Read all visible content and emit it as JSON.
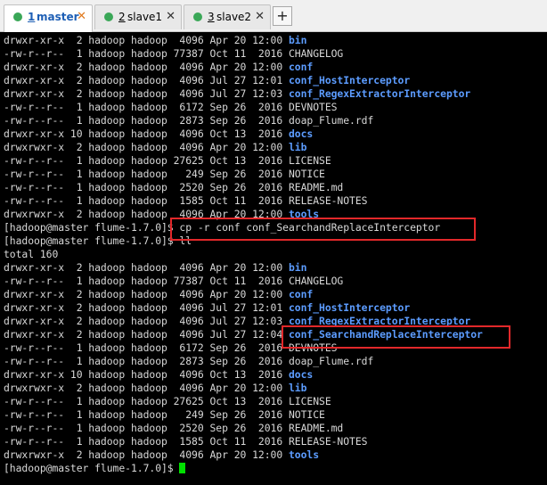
{
  "tabs": [
    {
      "number": "1",
      "label": " master",
      "dot_color": "#3aa757",
      "active": true
    },
    {
      "number": "2",
      "label": " slave1",
      "dot_color": "#3aa757",
      "active": false
    },
    {
      "number": "3",
      "label": " slave2",
      "dot_color": "#3aa757",
      "active": false
    }
  ],
  "new_tab_label": "+",
  "close_glyph": "✕",
  "colors": {
    "dir": "#5c9cff",
    "text": "#d8d8d8",
    "highlight": "#e2282a",
    "cursor": "#00e000"
  },
  "terminal_lines": [
    {
      "prefix": "drwxr-xr-x  2 hadoop hadoop  4096 Apr 20 12:00 ",
      "name": "bin",
      "dir": true
    },
    {
      "prefix": "-rw-r--r--  1 hadoop hadoop 77387 Oct 11  2016 ",
      "name": "CHANGELOG",
      "dir": false
    },
    {
      "prefix": "drwxr-xr-x  2 hadoop hadoop  4096 Apr 20 12:00 ",
      "name": "conf",
      "dir": true
    },
    {
      "prefix": "drwxr-xr-x  2 hadoop hadoop  4096 Jul 27 12:01 ",
      "name": "conf_HostInterceptor",
      "dir": true
    },
    {
      "prefix": "drwxr-xr-x  2 hadoop hadoop  4096 Jul 27 12:03 ",
      "name": "conf_RegexExtractorInterceptor",
      "dir": true
    },
    {
      "prefix": "-rw-r--r--  1 hadoop hadoop  6172 Sep 26  2016 ",
      "name": "DEVNOTES",
      "dir": false
    },
    {
      "prefix": "-rw-r--r--  1 hadoop hadoop  2873 Sep 26  2016 ",
      "name": "doap_Flume.rdf",
      "dir": false
    },
    {
      "prefix": "drwxr-xr-x 10 hadoop hadoop  4096 Oct 13  2016 ",
      "name": "docs",
      "dir": true
    },
    {
      "prefix": "drwxrwxr-x  2 hadoop hadoop  4096 Apr 20 12:00 ",
      "name": "lib",
      "dir": true
    },
    {
      "prefix": "-rw-r--r--  1 hadoop hadoop 27625 Oct 13  2016 ",
      "name": "LICENSE",
      "dir": false
    },
    {
      "prefix": "-rw-r--r--  1 hadoop hadoop   249 Sep 26  2016 ",
      "name": "NOTICE",
      "dir": false
    },
    {
      "prefix": "-rw-r--r--  1 hadoop hadoop  2520 Sep 26  2016 ",
      "name": "README.md",
      "dir": false
    },
    {
      "prefix": "-rw-r--r--  1 hadoop hadoop  1585 Oct 11  2016 ",
      "name": "RELEASE-NOTES",
      "dir": false
    },
    {
      "prefix": "drwxrwxr-x  2 hadoop hadoop  4096 Apr 20 12:00 ",
      "name": "tools",
      "dir": true
    },
    {
      "prefix": "[hadoop@master flume-1.7.0]$ cp -r conf conf_SearchandReplaceInterceptor",
      "name": "",
      "dir": false
    },
    {
      "prefix": "[hadoop@master flume-1.7.0]$ ll",
      "name": "",
      "dir": false
    },
    {
      "prefix": "total 160",
      "name": "",
      "dir": false
    },
    {
      "prefix": "drwxr-xr-x  2 hadoop hadoop  4096 Apr 20 12:00 ",
      "name": "bin",
      "dir": true
    },
    {
      "prefix": "-rw-r--r--  1 hadoop hadoop 77387 Oct 11  2016 ",
      "name": "CHANGELOG",
      "dir": false
    },
    {
      "prefix": "drwxr-xr-x  2 hadoop hadoop  4096 Apr 20 12:00 ",
      "name": "conf",
      "dir": true
    },
    {
      "prefix": "drwxr-xr-x  2 hadoop hadoop  4096 Jul 27 12:01 ",
      "name": "conf_HostInterceptor",
      "dir": true
    },
    {
      "prefix": "drwxr-xr-x  2 hadoop hadoop  4096 Jul 27 12:03 ",
      "name": "conf_RegexExtractorInterceptor",
      "dir": true
    },
    {
      "prefix": "drwxr-xr-x  2 hadoop hadoop  4096 Jul 27 12:04 ",
      "name": "conf_SearchandReplaceInterceptor",
      "dir": true
    },
    {
      "prefix": "-rw-r--r--  1 hadoop hadoop  6172 Sep 26  2016 ",
      "name": "DEVNOTES",
      "dir": false
    },
    {
      "prefix": "-rw-r--r--  1 hadoop hadoop  2873 Sep 26  2016 ",
      "name": "doap_Flume.rdf",
      "dir": false
    },
    {
      "prefix": "drwxr-xr-x 10 hadoop hadoop  4096 Oct 13  2016 ",
      "name": "docs",
      "dir": true
    },
    {
      "prefix": "drwxrwxr-x  2 hadoop hadoop  4096 Apr 20 12:00 ",
      "name": "lib",
      "dir": true
    },
    {
      "prefix": "-rw-r--r--  1 hadoop hadoop 27625 Oct 13  2016 ",
      "name": "LICENSE",
      "dir": false
    },
    {
      "prefix": "-rw-r--r--  1 hadoop hadoop   249 Sep 26  2016 ",
      "name": "NOTICE",
      "dir": false
    },
    {
      "prefix": "-rw-r--r--  1 hadoop hadoop  2520 Sep 26  2016 ",
      "name": "README.md",
      "dir": false
    },
    {
      "prefix": "-rw-r--r--  1 hadoop hadoop  1585 Oct 11  2016 ",
      "name": "RELEASE-NOTES",
      "dir": false
    },
    {
      "prefix": "drwxrwxr-x  2 hadoop hadoop  4096 Apr 20 12:00 ",
      "name": "tools",
      "dir": true
    },
    {
      "prefix": "[hadoop@master flume-1.7.0]$ ",
      "name": "",
      "dir": false,
      "cursor": true
    }
  ]
}
